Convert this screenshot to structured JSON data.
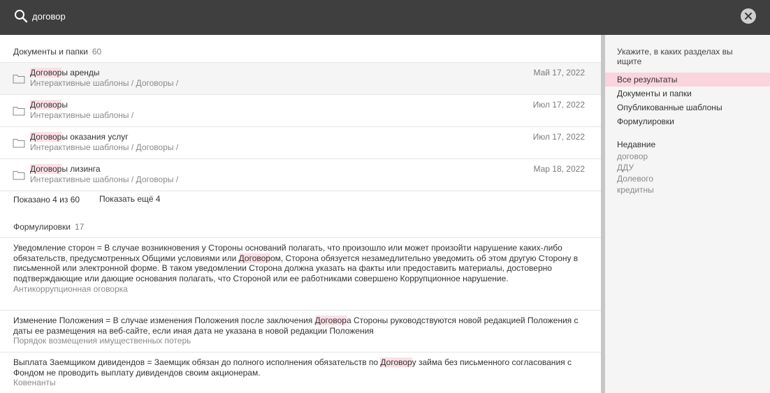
{
  "search": {
    "query": "договор",
    "icons": {
      "search": "search-icon",
      "clear": "close-icon"
    }
  },
  "documents_section": {
    "title": "Документы и папки",
    "count": "60",
    "rows": [
      {
        "title_match": "Договор",
        "title_rest": "ы аренды",
        "path": "Интерактивные шаблоны / Договоры /",
        "date": "Май 17, 2022",
        "icon": "folder-icon"
      },
      {
        "title_match": "Договор",
        "title_rest": "ы",
        "path": "Интерактивные шаблоны /",
        "date": "Июл 17, 2022",
        "icon": "folder-icon"
      },
      {
        "title_match": "Договор",
        "title_rest": "ы оказания услуг",
        "path": "Интерактивные шаблоны / Договоры /",
        "date": "Июл 17, 2022",
        "icon": "folder-icon"
      },
      {
        "title_match": "Договор",
        "title_rest": "ы лизинга",
        "path": "Интерактивные шаблоны / Договоры /",
        "date": "Мар 18, 2022",
        "icon": "folder-icon"
      }
    ],
    "shown": "Показано 4 из 60",
    "show_more": "Показать ещё 4"
  },
  "clauses_section": {
    "title": "Формулировки",
    "count": "17",
    "items": [
      {
        "text_before": "Уведомление сторон = В случае возникновения у Стороны оснований полагать, что произошло или может произойти нарушение каких-либо обязательств, предусмотренных Общими условиями или ",
        "match": "Договор",
        "text_after": "ом, Сторона обязуется незамедлительно уведомить об этом другую Сторону в письменной или электронной форме. В таком уведомлении Сторона должна указать на факты или предоставить материалы, достоверно подтверждающие или дающие основания полагать, что Стороной или ее работниками совершено Коррупционное нарушение.",
        "source": "Антикоррупционная оговорка"
      },
      {
        "text_before": "Изменение Положения = В случае изменения Положения после заключения ",
        "match": "Договор",
        "text_after": "а Стороны руководствуются новой редакцией Положения с даты ее размещения на веб-сайте, если иная дата не указана в новой редакции Положения",
        "source": "Порядок возмещения имущественных потерь"
      },
      {
        "text_before": "Выплата Заемщиком дивидендов = Заемщик обязан до полного исполнения обязательств по ",
        "match": "Договор",
        "text_after": "у займа без письменного согласования с Фондом не проводить выплату дивидендов своим акционерам.",
        "source": "Ковенанты"
      }
    ]
  },
  "filters": {
    "heading": "Укажите, в каких разделах вы ищите",
    "items": [
      "Все результаты",
      "Документы и папки",
      "Опубликованные шаблоны",
      "Формулировки"
    ],
    "active_index": 0,
    "recent_heading": "Недавние",
    "recent": [
      "договор",
      "ДДУ",
      "Долевого",
      "кредитны"
    ]
  },
  "colors": {
    "topbar": "#3f3f3f",
    "highlight": "#fbe0e6",
    "active_filter": "#fad4df",
    "sidebar_bg": "#f5f5f5"
  }
}
